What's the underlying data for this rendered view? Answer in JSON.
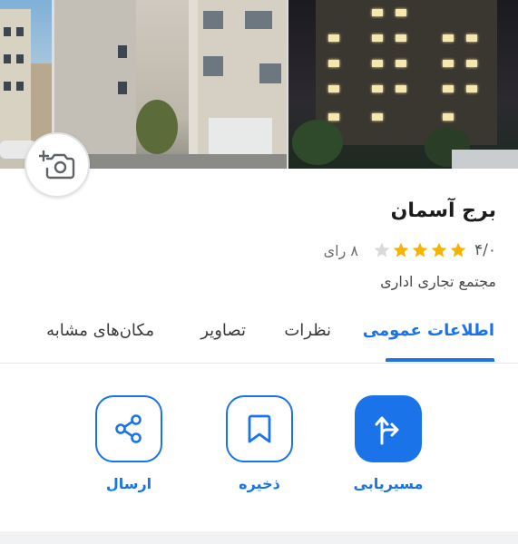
{
  "place": {
    "title": "برج آسمان",
    "rating_value": "۴/۰",
    "rating_count": "۸ رای",
    "stars_filled": 4,
    "stars_total": 5,
    "category": "مجتمع تجاری اداری"
  },
  "tabs": [
    {
      "label": "اطلاعات عمومی",
      "active": true
    },
    {
      "label": "نظرات",
      "active": false
    },
    {
      "label": "تصاویر",
      "active": false
    },
    {
      "label": "مکان‌های مشابه",
      "active": false
    }
  ],
  "actions": {
    "route_label": "مسیریابی",
    "save_label": "ذخیره",
    "share_label": "ارسال"
  },
  "icons": {
    "camera": "camera-add-icon",
    "route": "route-turn-icon",
    "save": "bookmark-icon",
    "share": "share-icon"
  },
  "colors": {
    "accent": "#1a73e8",
    "star": "#f6b400",
    "star_empty": "#d9d9d9"
  }
}
